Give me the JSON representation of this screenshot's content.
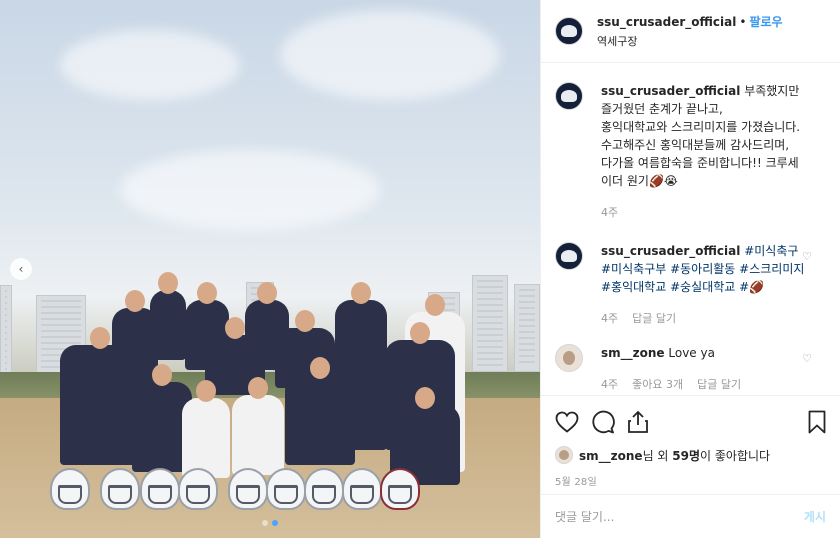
{
  "post": {
    "author": "ssu_crusader_official",
    "separator": "•",
    "follow_label": "팔로우",
    "location": "역세구장"
  },
  "comments": [
    {
      "user": "ssu_crusader_official",
      "text": "부족했지만 즐거웠던 춘계가 끝나고,\n홍익대학교와 스크리미지를 가졌습니다.\n수고해주신 홍익대분들께 감사드리며,\n다가올 여름합숙을 준비합니다!! 크루세이더 원기🏈😭",
      "age": "4주"
    },
    {
      "user": "ssu_crusader_official",
      "tags": "#미식축구 #미식축구부 #동아리활동 #스크리미지 #홍익대학교 #숭실대학교 #🏈",
      "age": "4주",
      "reply_label": "답글 달기"
    },
    {
      "user": "sm__zone",
      "text": "Love ya",
      "age": "4주",
      "likes_label": "좋아요 3개",
      "reply_label": "답글 달기"
    }
  ],
  "likes": {
    "user": "sm__zone",
    "suffix": "님 외 ",
    "count": "59명",
    "tail": "이 좋아합니다"
  },
  "date": "5월 28일",
  "comment_box": {
    "placeholder": "댓글 달기...",
    "post_label": "게시"
  },
  "icons": {
    "like": "heart-icon",
    "comment": "comment-icon",
    "share": "share-icon",
    "save": "bookmark-icon",
    "prev": "chevron-left-icon"
  },
  "colors": {
    "accent": "#3897f0",
    "hashtag": "#003569",
    "muted": "#999999"
  },
  "carousel": {
    "slides": 2,
    "active": 2
  }
}
